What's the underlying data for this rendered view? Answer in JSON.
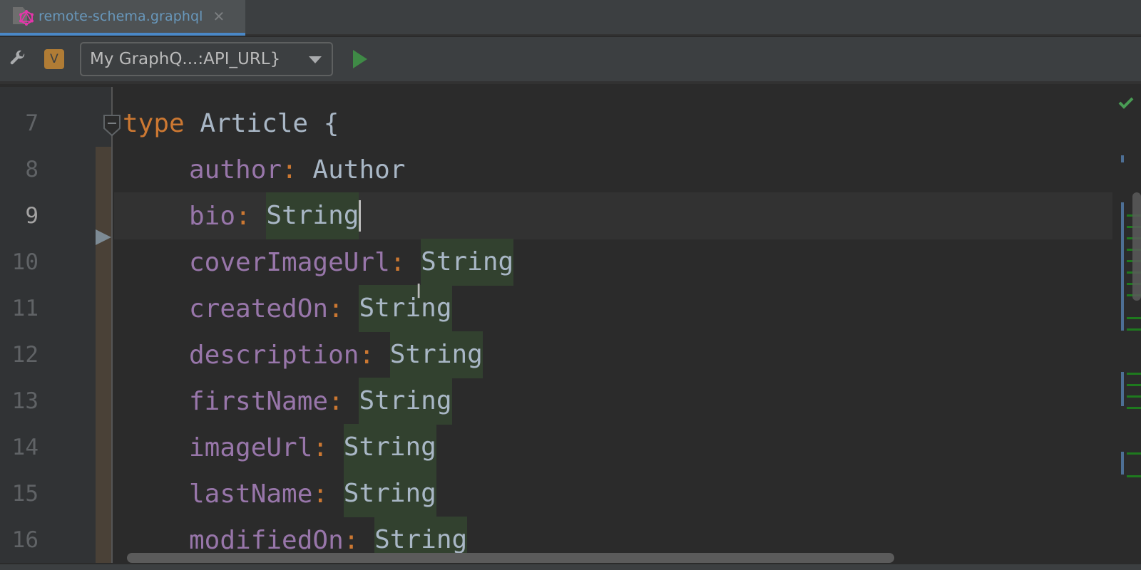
{
  "tab": {
    "file_name": "remote-schema.graphql",
    "icon": "graphql-file-icon",
    "close_glyph": "✕"
  },
  "toolbar": {
    "settings_icon": "wrench-icon",
    "variables_badge": "V",
    "endpoint_selector": "My GraphQ...:API_URL}",
    "run_icon": "run-icon"
  },
  "editor": {
    "line_numbers": [
      "7",
      "8",
      "9",
      "10",
      "11",
      "12",
      "13",
      "14",
      "15",
      "16"
    ],
    "current_line": "9",
    "lines": [
      {
        "keyword": "type",
        "name": "Article",
        "brace": "{"
      },
      {
        "field": "author",
        "type": "Author",
        "highlighted": false
      },
      {
        "field": "bio",
        "type": "String",
        "highlighted": true
      },
      {
        "field": "coverImageUrl",
        "type": "String",
        "highlighted": true
      },
      {
        "field": "createdOn",
        "type": "String",
        "highlighted": true
      },
      {
        "field": "description",
        "type": "String",
        "highlighted": true
      },
      {
        "field": "firstName",
        "type": "String",
        "highlighted": true
      },
      {
        "field": "imageUrl",
        "type": "String",
        "highlighted": true
      },
      {
        "field": "lastName",
        "type": "String",
        "highlighted": true
      },
      {
        "field": "modifiedOn",
        "type": "String",
        "highlighted": true
      }
    ],
    "colon": ":",
    "inspection_status": "no-problems-check-icon"
  },
  "colors": {
    "keyword": "#cc7832",
    "field": "#9876aa",
    "type": "#a9b7c6",
    "added_highlight": "#32412f",
    "tab_accent": "#4a88c7",
    "badge": "#b07c35",
    "run": "#3f8a46"
  }
}
